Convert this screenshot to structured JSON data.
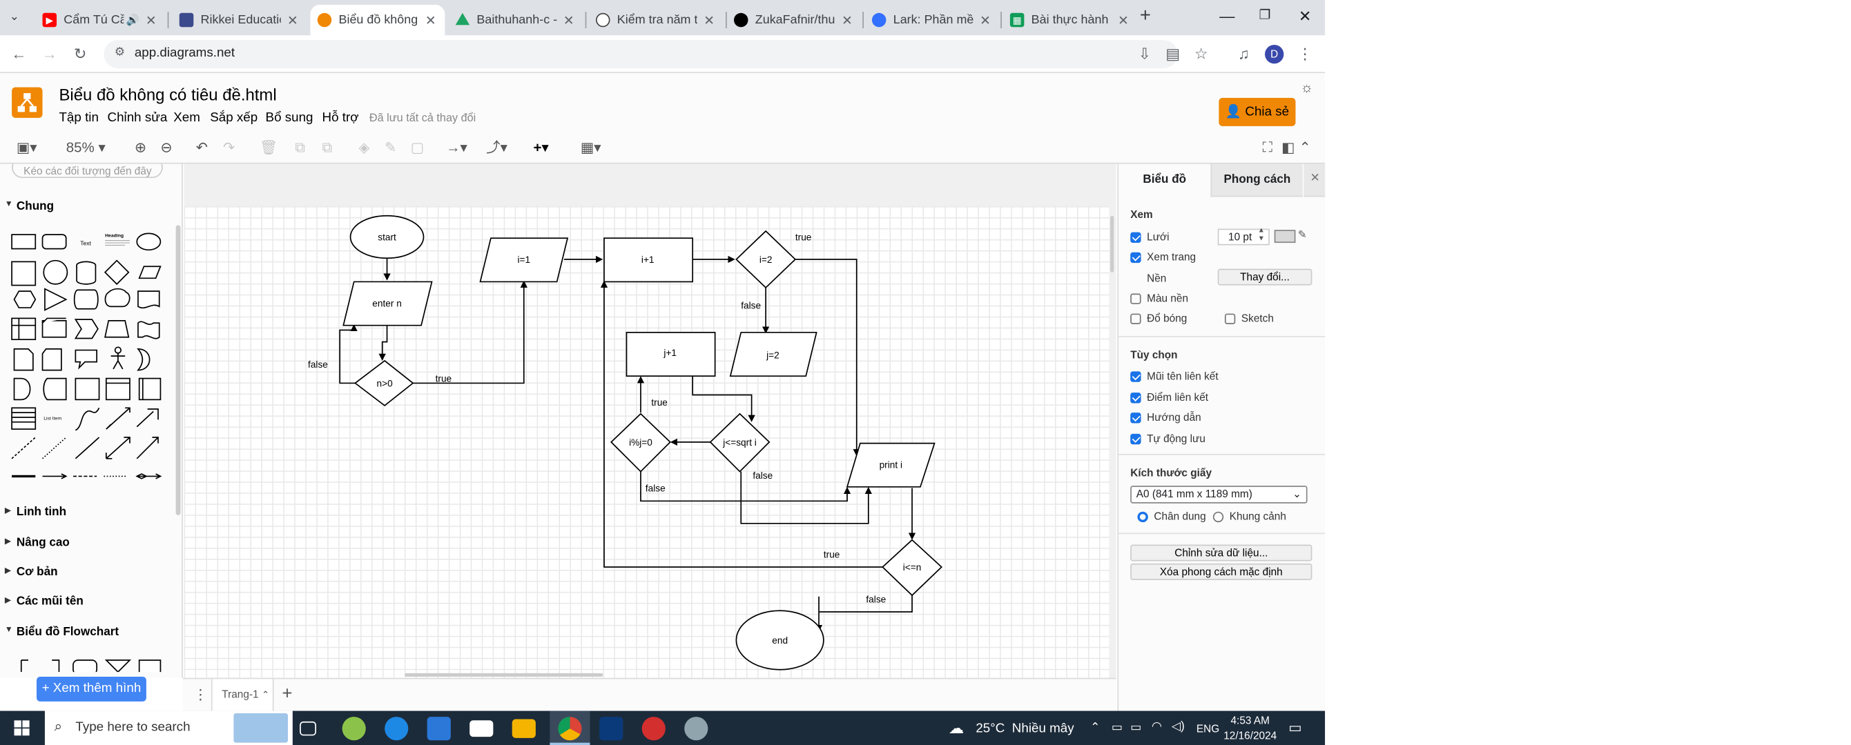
{
  "browser": {
    "tabs": [
      {
        "title": "Cẩm Tú Cầu",
        "favicon": "youtube-icon",
        "color": "#ff0000"
      },
      {
        "title": "Rikkei Education",
        "favicon": "rikkei-icon",
        "color": "#3b4a8c"
      },
      {
        "title": "Biểu đồ không c",
        "favicon": "drawio-icon",
        "color": "#f08705",
        "active": true
      },
      {
        "title": "Baithuhanh-c - G",
        "favicon": "drive-icon",
        "color": "#1fa463"
      },
      {
        "title": "Kiểm tra năm tiế",
        "favicon": "openai-icon",
        "color": "#444444"
      },
      {
        "title": "ZukaFafnir/thuch",
        "favicon": "github-icon",
        "color": "#000000"
      },
      {
        "title": "Lark: Phần mềm",
        "favicon": "lark-icon",
        "color": "#3370ff"
      },
      {
        "title": "Bài thực hành C",
        "favicon": "sheets-icon",
        "color": "#0f9d58"
      }
    ],
    "new_tab": "+",
    "url": "app.diagrams.net",
    "profile_initial": "D"
  },
  "app": {
    "doc_title": "Biểu đồ không có tiêu đề.html",
    "menus": [
      "Tập tin",
      "Chỉnh sửa",
      "Xem",
      "Sắp xếp",
      "Bổ sung",
      "Hỗ trợ"
    ],
    "saved_status": "Đã lưu tất cả thay đổi",
    "share_label": "Chia sẻ",
    "zoom": "85%"
  },
  "left_panel": {
    "search_placeholder": "Kéo các đối tượng đến đây",
    "sections": [
      {
        "label": "Chung",
        "expanded": true
      },
      {
        "label": "Linh tinh",
        "expanded": false
      },
      {
        "label": "Nâng cao",
        "expanded": false
      },
      {
        "label": "Cơ bản",
        "expanded": false
      },
      {
        "label": "Các mũi tên",
        "expanded": false
      },
      {
        "label": "Biểu đồ Flowchart",
        "expanded": true
      }
    ],
    "shape_text_label": "Text",
    "shape_heading_label": "Heading",
    "shape_list_label": "List Item",
    "more_shapes": "+ Xem thêm hình"
  },
  "diagram": {
    "nodes": {
      "start": "start",
      "enter_n": "enter n",
      "n_gt_0": "n>0",
      "i_eq_1": "i=1",
      "i_plus_1": "i+1",
      "i_eq_2": "i=2",
      "j_plus_1": "j+1",
      "j_eq_2": "j=2",
      "i_mod_j": "i%j=0",
      "j_le_sqrt": "j<=sqrt i",
      "print_i": "print i",
      "i_le_n": "i<=n",
      "end": "end"
    },
    "edge_labels": {
      "false1": "false",
      "true1": "true",
      "true2": "true",
      "false2": "false",
      "true3": "true",
      "false3": "false",
      "false4": "false",
      "true4": "true",
      "false5": "false"
    }
  },
  "page_tab": "Trang-1",
  "right_panel": {
    "tabs": [
      "Biểu đồ",
      "Phong cách"
    ],
    "view_heading": "Xem",
    "grid_label": "Lưới",
    "grid_value": "10 pt",
    "page_view_label": "Xem trang",
    "background_label": "Nền",
    "change_button": "Thay đổi...",
    "bg_color_label": "Màu nền",
    "shadow_label": "Đổ bóng",
    "sketch_label": "Sketch",
    "options_heading": "Tùy chọn",
    "options": [
      "Mũi tên liên kết",
      "Điểm liên kết",
      "Hướng dẫn",
      "Tự động lưu"
    ],
    "paper_heading": "Kích thước giấy",
    "paper_value": "A0 (841 mm x 1189 mm)",
    "portrait_label": "Chân dung",
    "landscape_label": "Khung cảnh",
    "edit_data_button": "Chỉnh sửa dữ liệu...",
    "clear_style_button": "Xóa phong cách mặc định"
  },
  "taskbar": {
    "search_placeholder": "Type here to search",
    "weather": "25°C  Nhiều mây",
    "lang": "ENG",
    "time": "4:53 AM",
    "date": "12/16/2024"
  }
}
